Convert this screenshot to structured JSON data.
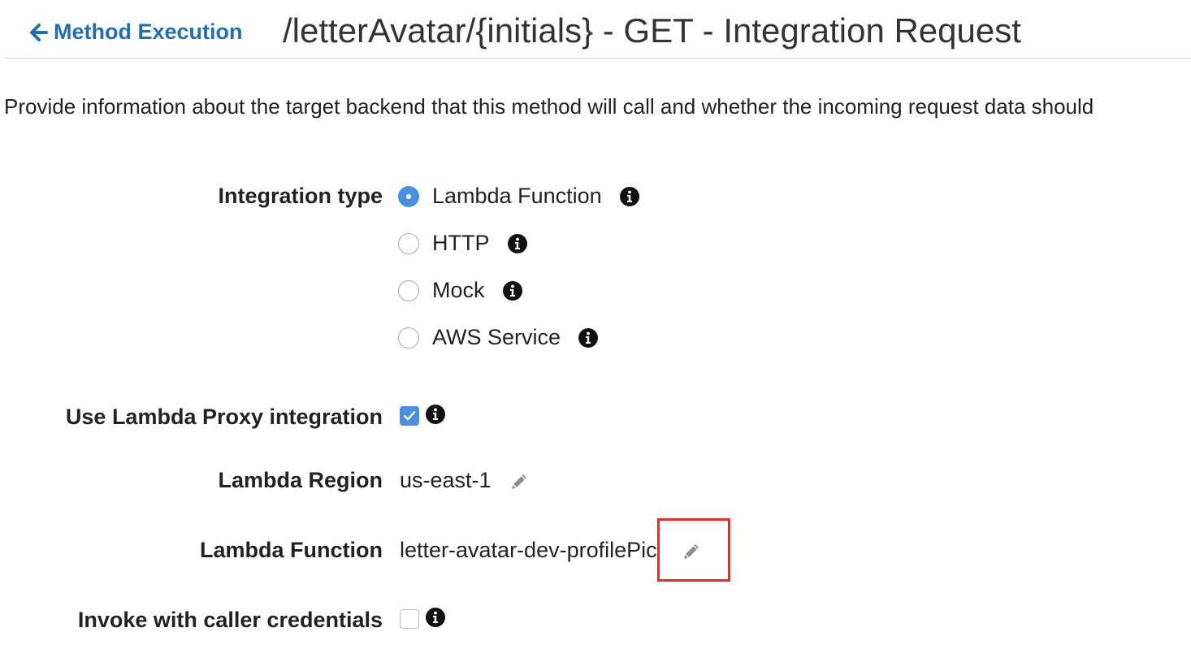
{
  "header": {
    "back_label": "Method Execution",
    "title": "/letterAvatar/{initials} - GET - Integration Request"
  },
  "description": "Provide information about the target backend that this method will call and whether the incoming request data should",
  "integration_type": {
    "label": "Integration type",
    "options": [
      {
        "label": "Lambda Function",
        "selected": true
      },
      {
        "label": "HTTP",
        "selected": false
      },
      {
        "label": "Mock",
        "selected": false
      },
      {
        "label": "AWS Service",
        "selected": false
      }
    ]
  },
  "proxy": {
    "label": "Use Lambda Proxy integration",
    "checked": true
  },
  "region": {
    "label": "Lambda Region",
    "value": "us-east-1"
  },
  "function": {
    "label": "Lambda Function",
    "value": "letter-avatar-dev-profilePic"
  },
  "caller_credentials": {
    "label": "Invoke with caller credentials",
    "checked": false
  },
  "colors": {
    "link": "#1f6fb5",
    "radio_selected": "#4a90e2",
    "highlight": "#e0302a"
  },
  "icons": [
    "arrow-left-icon",
    "info-icon",
    "pencil-icon",
    "checkmark-icon"
  ]
}
